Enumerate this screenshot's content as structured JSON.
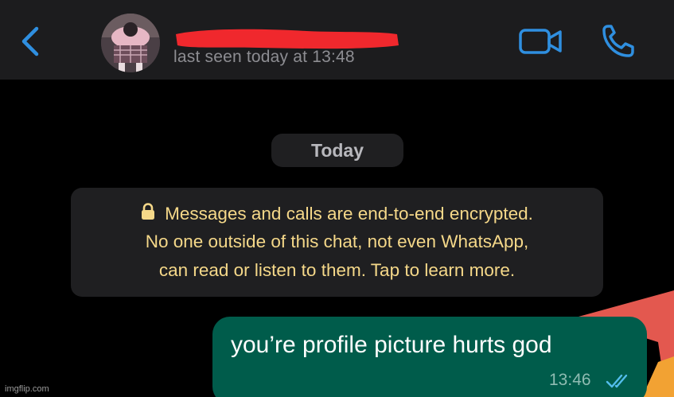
{
  "header": {
    "last_seen": "last seen today at 13:48",
    "icons": {
      "back": "chevron-left-icon",
      "video": "video-camera-icon",
      "phone": "phone-icon"
    },
    "accent_color": "#2f8fe0",
    "redaction_color": "#f0282d"
  },
  "chat": {
    "date_chip": "Today",
    "encryption_notice": {
      "line1": "Messages and calls are end-to-end encrypted.",
      "line2": "No one outside of this chat, not even WhatsApp,",
      "line3": "can read or listen to them. Tap to learn more.",
      "icon": "lock-icon",
      "color": "#f5d889"
    },
    "messages": [
      {
        "direction": "outgoing",
        "text": "you’re profile picture hurts god",
        "time": "13:46",
        "status": "read",
        "status_icon": "double-check-icon",
        "bubble_color": "#005c4b"
      }
    ]
  },
  "watermark": "imgflip.com"
}
